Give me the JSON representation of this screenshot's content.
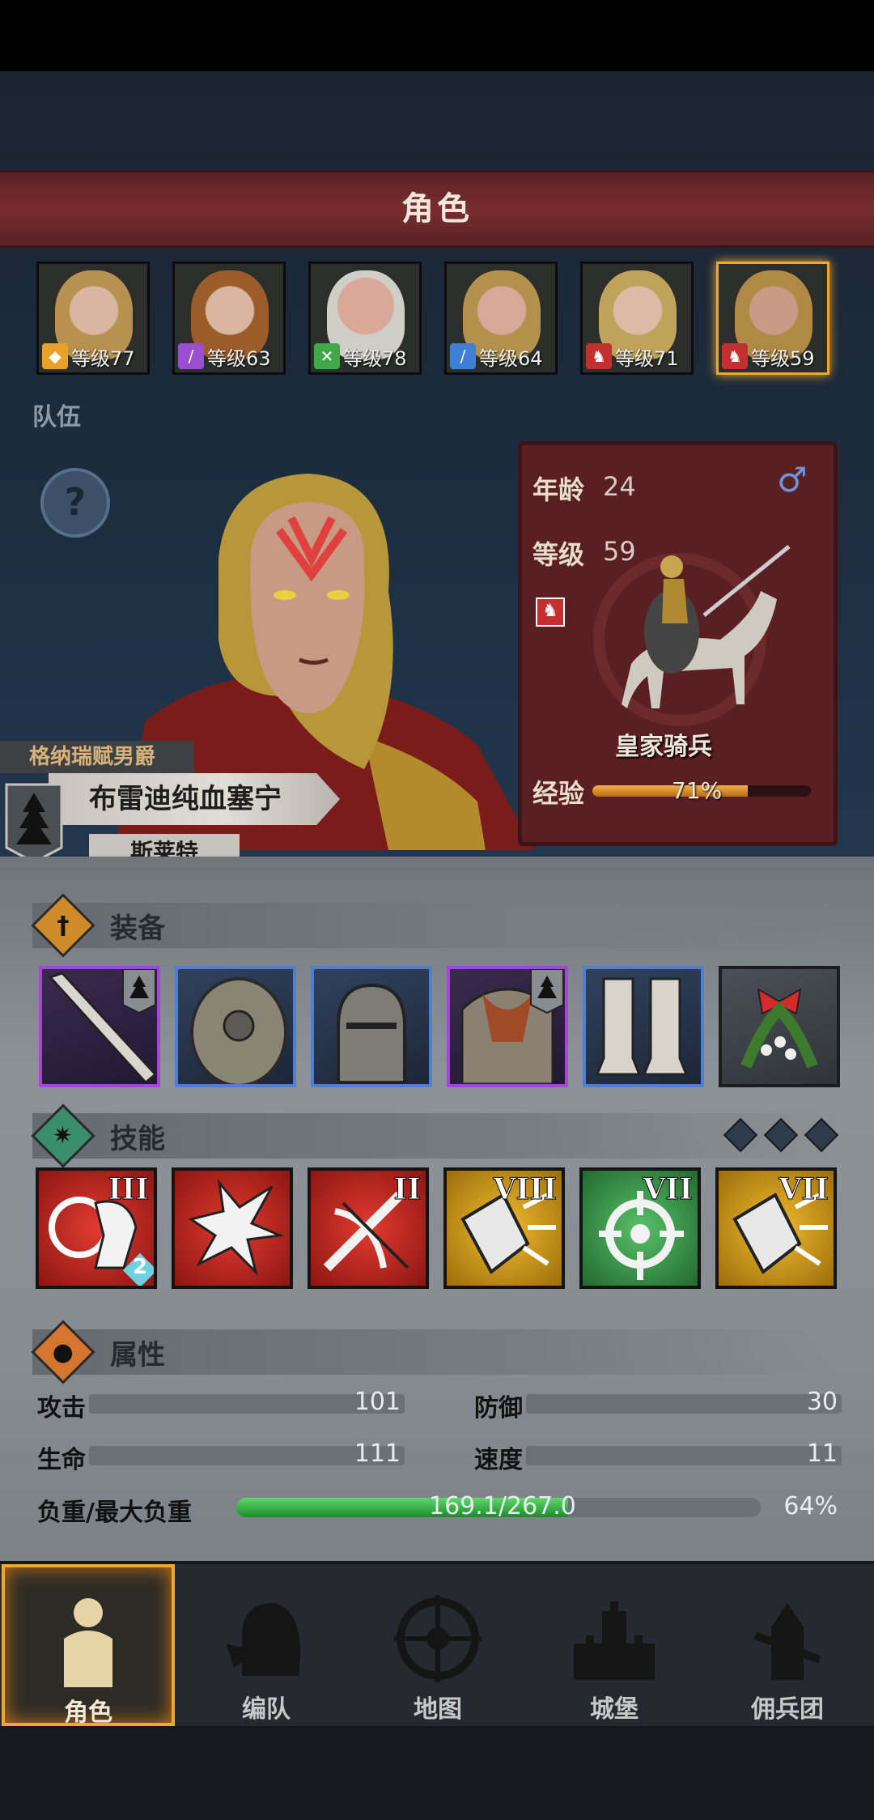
{
  "header": {
    "title": "角色"
  },
  "roster": [
    {
      "level_text": "等级77",
      "class_icon": "shield-class-icon",
      "class_color": "#e8a227"
    },
    {
      "level_text": "等级63",
      "class_icon": "staff-class-icon",
      "class_color": "#9a4fd0"
    },
    {
      "level_text": "等级78",
      "class_icon": "bow-class-icon",
      "class_color": "#3fa94a"
    },
    {
      "level_text": "等级64",
      "class_icon": "sword-class-icon",
      "class_color": "#3f7fd8"
    },
    {
      "level_text": "等级71",
      "class_icon": "horse-class-icon",
      "class_color": "#c43030"
    },
    {
      "level_text": "等级59",
      "class_icon": "horse-class-icon",
      "class_color": "#c43030",
      "selected": true
    }
  ],
  "team_label": "队伍",
  "character": {
    "title": "格纳瑞赋男爵",
    "name": "布雷迪纯血塞宁",
    "region": "斯莱特",
    "age_label": "年龄",
    "age": "24",
    "gender_symbol": "♂",
    "level_label": "等级",
    "level": "59",
    "unit_type": "皇家骑兵",
    "exp_label": "经验",
    "exp_text": "71%",
    "exp_fraction": 0.71
  },
  "equipment_section": {
    "title": "装备"
  },
  "equipment": [
    {
      "name": "greatsword-item",
      "rarity_color": "#a546d8",
      "crest": true
    },
    {
      "name": "round-shield-item",
      "rarity_color": "#4f7fd0",
      "crest": false
    },
    {
      "name": "helmet-item",
      "rarity_color": "#4f7fd0",
      "crest": false
    },
    {
      "name": "chainmail-armor-item",
      "rarity_color": "#a546d8",
      "crest": true
    },
    {
      "name": "greaves-item",
      "rarity_color": "#4f7fd0",
      "crest": false
    },
    {
      "name": "mistletoe-item",
      "rarity_color": "#1c1c1c",
      "crest": false
    }
  ],
  "skills_section": {
    "title": "技能"
  },
  "skills": [
    {
      "name": "charge-target-skill",
      "tier": "III",
      "bg": "#c3231d",
      "badge": "2"
    },
    {
      "name": "impact-strike-skill",
      "tier": "",
      "bg": "#c3231d",
      "badge": ""
    },
    {
      "name": "crossbow-skill",
      "tier": "II",
      "bg": "#c3231d",
      "badge": ""
    },
    {
      "name": "shield-burst-skill",
      "tier": "VIII",
      "bg": "#d39a16",
      "badge": ""
    },
    {
      "name": "crosshair-skill",
      "tier": "VII",
      "bg": "#3b9c4a",
      "badge": ""
    },
    {
      "name": "shield-burst-skill-2",
      "tier": "VII",
      "bg": "#d39a16",
      "badge": ""
    }
  ],
  "attributes_section": {
    "title": "属性"
  },
  "attributes": {
    "attack_label": "攻击",
    "attack": "101",
    "defense_label": "防御",
    "defense": "30",
    "hp_label": "生命",
    "hp": "111",
    "speed_label": "速度",
    "speed": "11",
    "load_label": "负重/最大负重",
    "load_text": "169.1/267.0",
    "load_percent": "64%",
    "load_fraction": 0.633
  },
  "nav": [
    {
      "label": "角色",
      "icon": "knight-icon",
      "active": true
    },
    {
      "label": "编队",
      "icon": "helmet-formation-icon",
      "active": false
    },
    {
      "label": "地图",
      "icon": "compass-icon",
      "active": false
    },
    {
      "label": "城堡",
      "icon": "castle-icon",
      "active": false
    },
    {
      "label": "佣兵团",
      "icon": "mercenary-icon",
      "active": false
    }
  ]
}
